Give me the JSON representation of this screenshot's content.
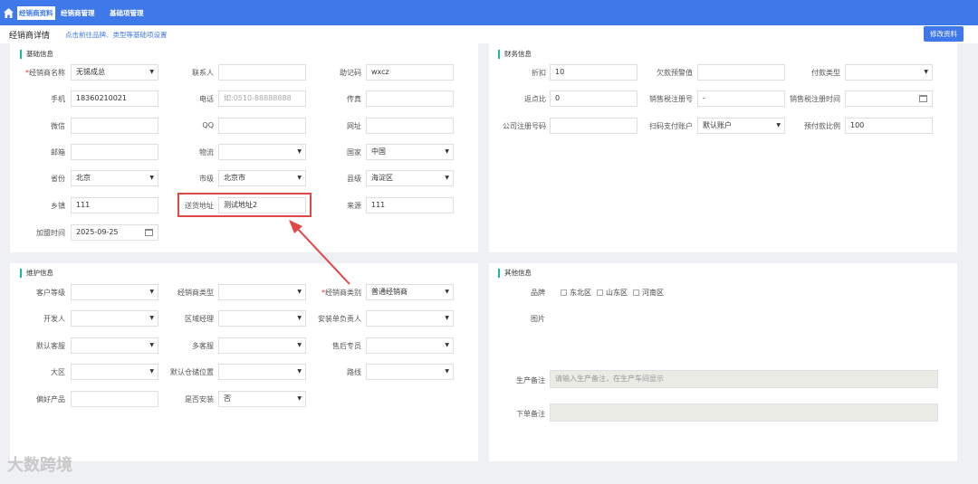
{
  "nav": {
    "tabs": [
      "经销商资料",
      "经销商管理",
      "基础项管理"
    ]
  },
  "header": {
    "title": "经销商详情",
    "hint": "点击前往品牌、类型等基础项设置",
    "edit_button": "修改资料"
  },
  "basic": {
    "title": "基础信息",
    "name_label": "经销商名称",
    "name_value": "无锡成总",
    "contact_label": "联系人",
    "contact_value": "",
    "mnemonic_label": "助记码",
    "mnemonic_value": "wxcz",
    "mobile_label": "手机",
    "mobile_value": "18360210021",
    "phone_label": "电话",
    "phone_placeholder": "如:0510-88888888",
    "fax_label": "传真",
    "fax_value": "",
    "wechat_label": "微信",
    "qq_label": "QQ",
    "website_label": "网址",
    "email_label": "邮箱",
    "logistics_label": "物流",
    "country_label": "国家",
    "country_value": "中国",
    "province_label": "省份",
    "province_value": "北京",
    "city_label": "市级",
    "city_value": "北京市",
    "county_label": "县级",
    "county_value": "海淀区",
    "town_label": "乡镇",
    "town_value": "111",
    "delivery_label": "送货地址",
    "delivery_value": "测试地址2",
    "source_label": "来源",
    "source_value": "111",
    "join_label": "加盟时间",
    "join_value": "2025-09-25"
  },
  "finance": {
    "title": "财务信息",
    "discount_label": "折扣",
    "discount_value": "10",
    "arrears_label": "欠款预警值",
    "arrears_value": "",
    "payment_label": "付款类型",
    "payment_value": "",
    "rebate_label": "返点比",
    "rebate_value": "0",
    "tax_no_label": "销售税注册号",
    "tax_no_value": "-",
    "tax_time_label": "销售税注册时间",
    "tax_time_value": "",
    "company_no_label": "公司注册号码",
    "company_no_value": "",
    "scan_label": "扫码支付账户",
    "scan_value": "默认账户",
    "prepay_label": "预付款比例",
    "prepay_value": "100"
  },
  "maintain": {
    "title": "维护信息",
    "level_label": "客户等级",
    "dealer_type_label": "经销商类型",
    "dealer_cat_label": "经销商类别",
    "dealer_cat_value": "普通经销商",
    "developer_label": "开发人",
    "region_mgr_label": "区域经理",
    "install_label": "安装单负责人",
    "service_label": "默认客服",
    "multi_service_label": "多客服",
    "after_sales_label": "售后专员",
    "big_region_label": "大区",
    "warehouse_label": "默认仓储位置",
    "route_label": "路线",
    "prefer_label": "偏好产品",
    "need_install_label": "是否安装",
    "need_install_value": "否"
  },
  "other": {
    "title": "其他信息",
    "brand_label": "品牌",
    "brands": [
      "东北区",
      "山东区",
      "河南区"
    ],
    "image_label": "图片",
    "prod_note_label": "生产备注",
    "prod_note_placeholder": "请输入生产备注，在生产车间显示",
    "order_note_label": "下单备注"
  },
  "watermark": "大数跨境",
  "colors": {
    "accent": "#3f78e8",
    "panel_bar": "#19b6a6",
    "highlight": "#e04848"
  }
}
